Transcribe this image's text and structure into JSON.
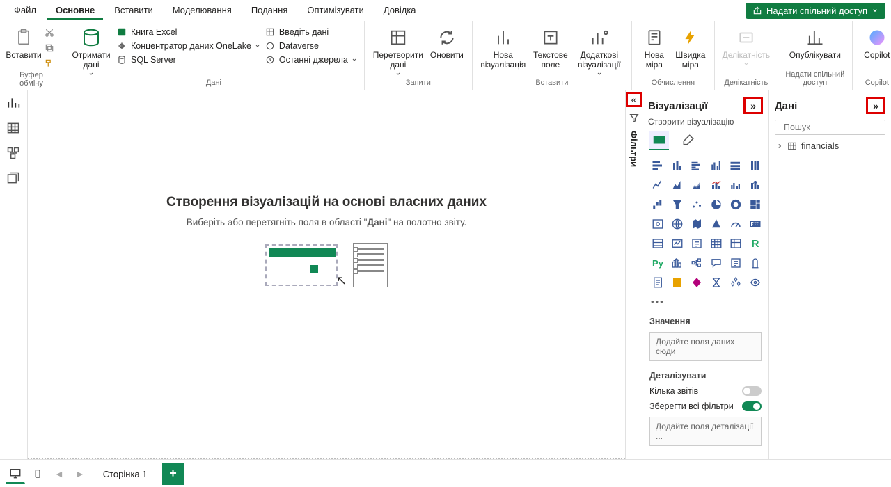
{
  "menu": {
    "file": "Файл",
    "home": "Основне",
    "insert": "Вставити",
    "modeling": "Моделювання",
    "view": "Подання",
    "optimize": "Оптимізувати",
    "help": "Довідка"
  },
  "share_button": "Надати спільний доступ",
  "ribbon": {
    "clipboard": {
      "paste": "Вставити",
      "label": "Буфер обміну"
    },
    "data": {
      "get_data": "Отримати дані",
      "excel": "Книга Excel",
      "onelake": "Концентратор даних OneLake",
      "sql": "SQL Server",
      "enter_data": "Введіть дані",
      "dataverse": "Dataverse",
      "recent": "Останні джерела",
      "label": "Дані"
    },
    "queries": {
      "transform": "Перетворити дані",
      "refresh": "Оновити",
      "label": "Запити"
    },
    "insert": {
      "new_visual": "Нова візуалізація",
      "text_box": "Текстове поле",
      "more_visuals": "Додаткові візуалізації",
      "label": "Вставити"
    },
    "calc": {
      "new_measure": "Нова міра",
      "quick_measure": "Швидка міра",
      "label": "Обчислення"
    },
    "sensitivity": {
      "btn": "Делікатність",
      "label": "Делікатність"
    },
    "publish": {
      "btn": "Опублікувати",
      "label": "Надати спільний доступ"
    },
    "copilot": {
      "btn": "Copilot",
      "label": "Copilot"
    }
  },
  "canvas": {
    "title": "Створення візуалізацій на основі власних даних",
    "subtitle_a": "Виберіть або перетягніть поля в області \"",
    "subtitle_b": "Дані",
    "subtitle_c": "\" на полотно звіту."
  },
  "filters_label": "Фільтри",
  "viz_pane": {
    "title": "Візуалізації",
    "subtitle": "Створити візуалізацію",
    "values_label": "Значення",
    "values_placeholder": "Додайте поля даних сюди",
    "drill_label": "Деталізувати",
    "cross_report": "Кілька звітів",
    "keep_filters": "Зберегти всі фільтри",
    "drill_placeholder": "Додайте поля деталізації ..."
  },
  "data_pane": {
    "title": "Дані",
    "search_placeholder": "Пошук",
    "table1": "financials"
  },
  "page_tab": "Сторінка 1"
}
